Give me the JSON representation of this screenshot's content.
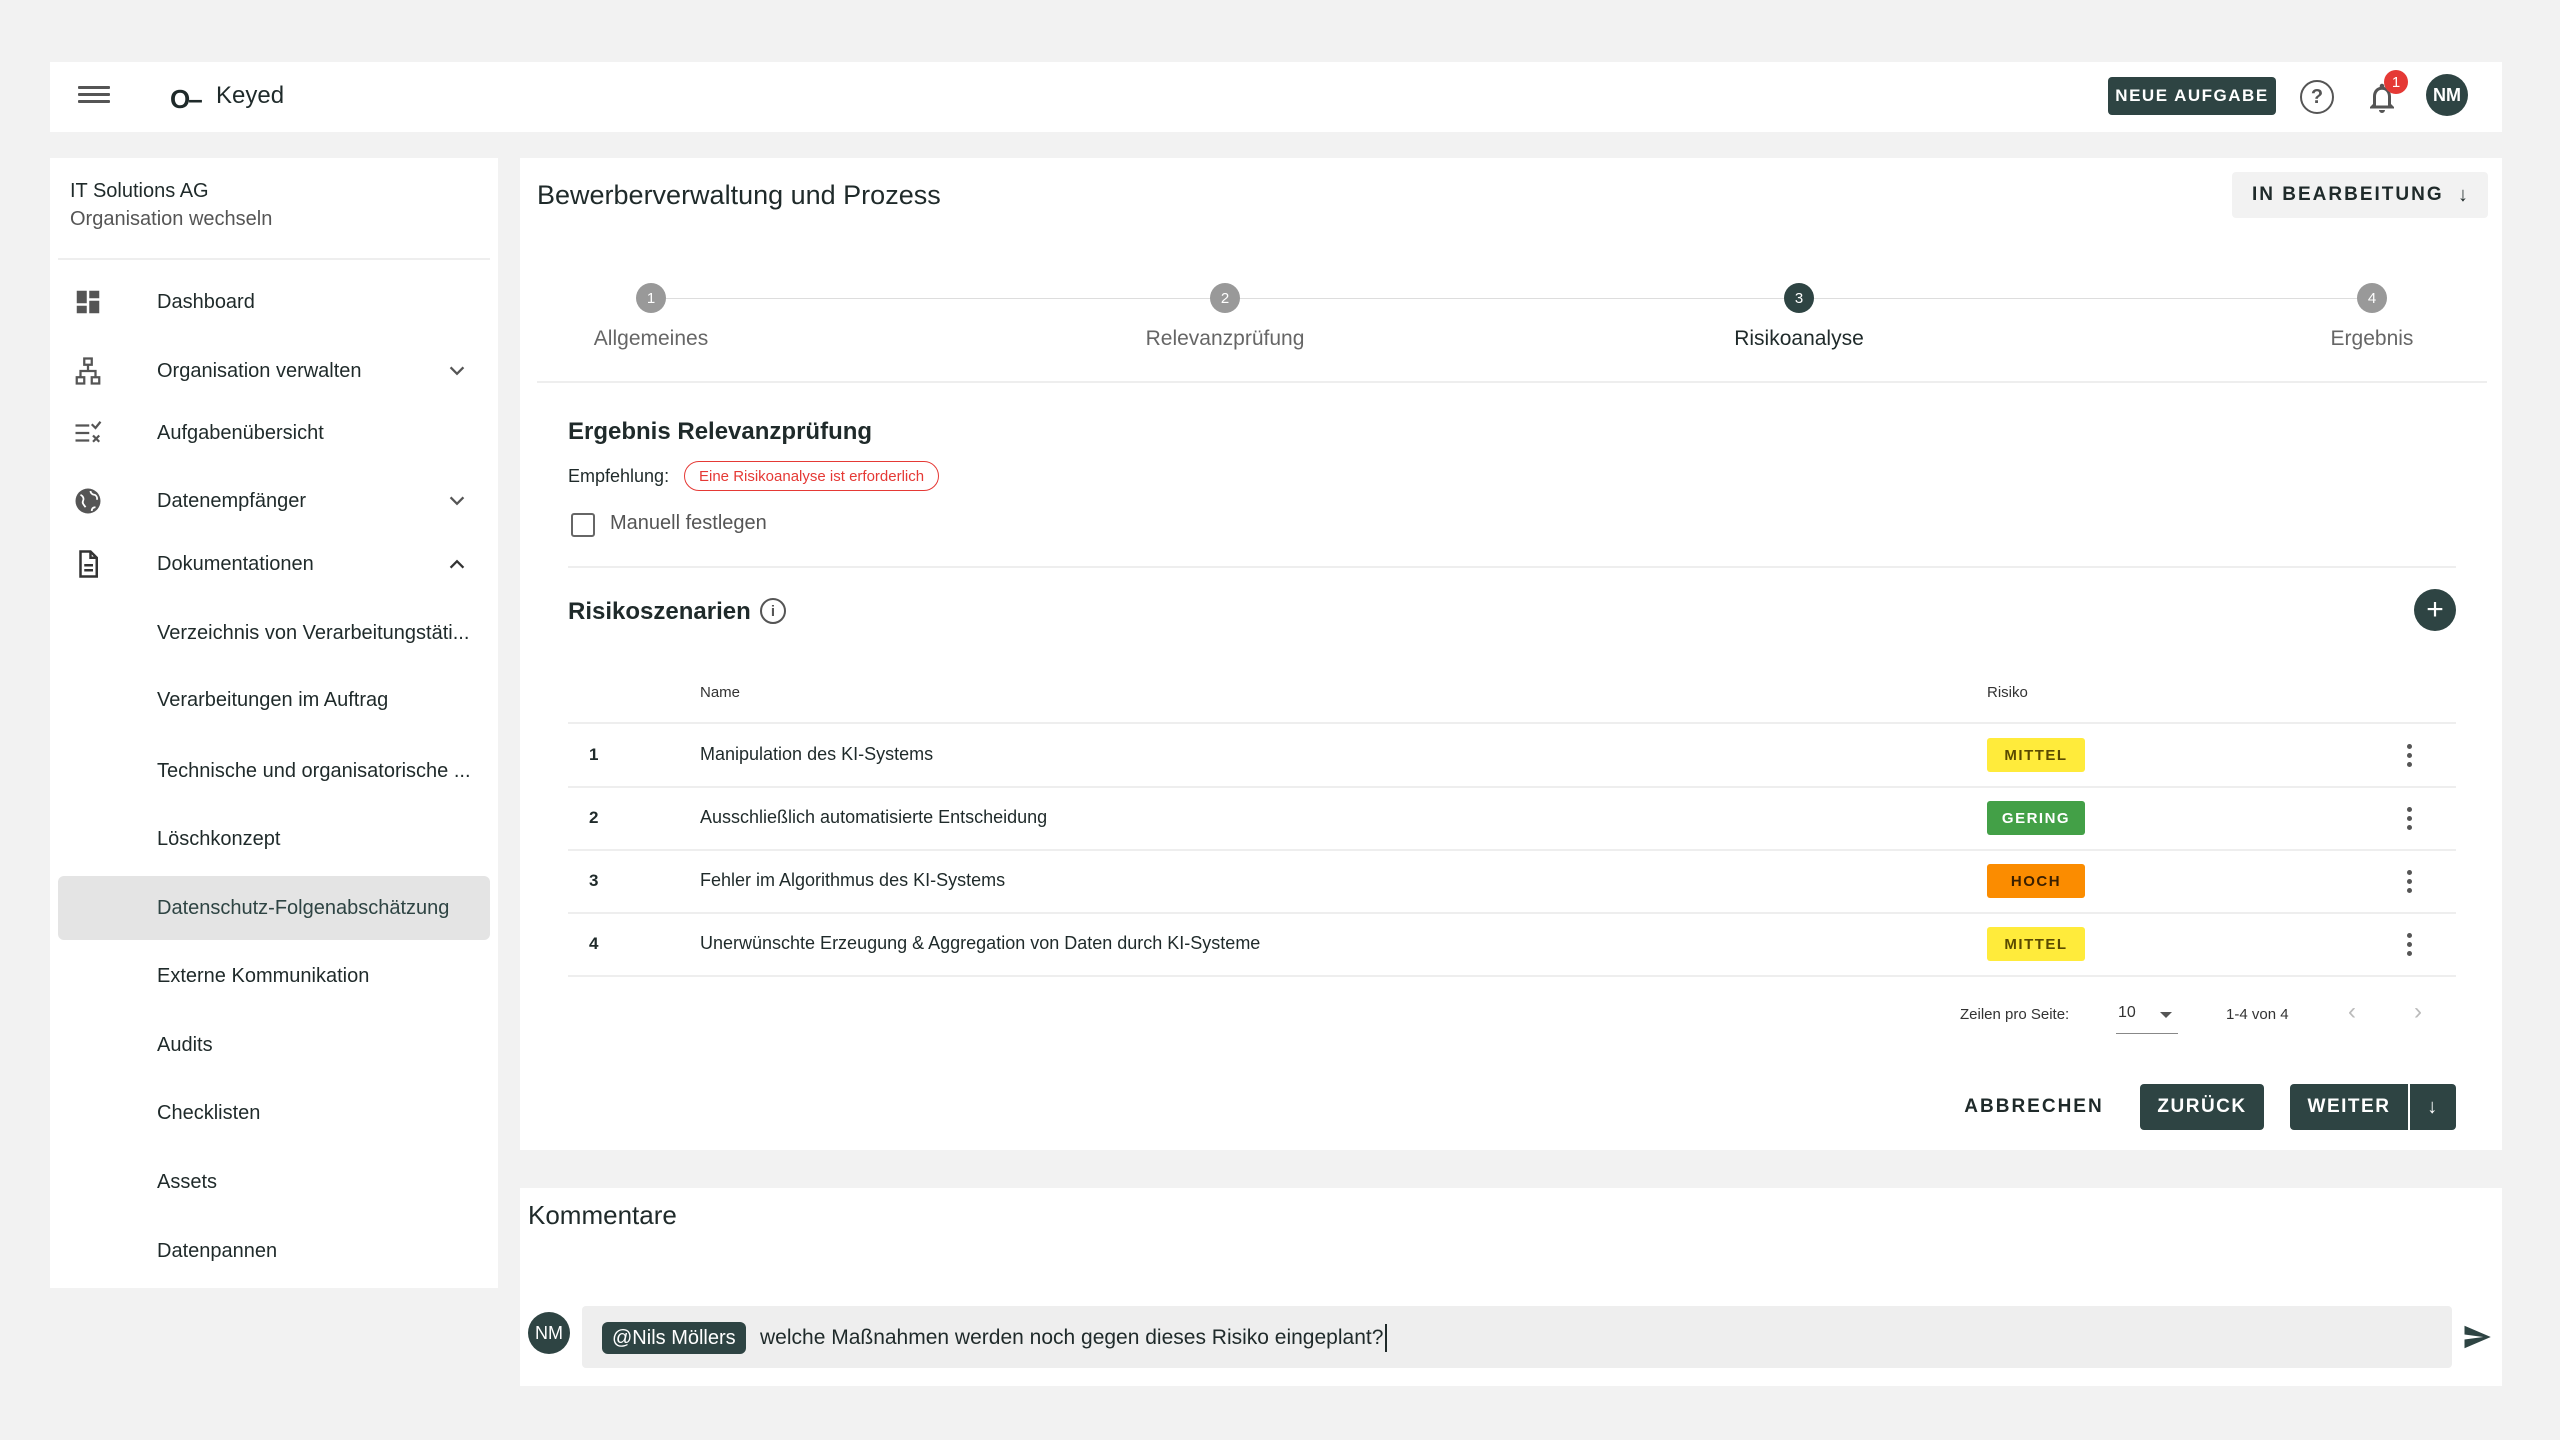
{
  "app": {
    "logo_mark": "O–",
    "logo_text": "Keyed",
    "new_task_label": "NEUE AUFGABE",
    "help_glyph": "?",
    "notifications_count": "1",
    "user_initials": "NM"
  },
  "sidebar": {
    "org_name": "IT Solutions AG",
    "org_switch": "Organisation wechseln",
    "items": [
      {
        "label": "Dashboard",
        "icon": "dashboard-icon"
      },
      {
        "label": "Organisation verwalten",
        "icon": "sitemap-icon",
        "chevron": "down"
      },
      {
        "label": "Aufgabenübersicht",
        "icon": "checklist-icon"
      },
      {
        "label": "Datenempfänger",
        "icon": "globe-icon",
        "chevron": "down"
      },
      {
        "label": "Dokumentationen",
        "icon": "document-icon",
        "chevron": "up"
      }
    ],
    "sub_items": [
      "Verzeichnis von Verarbeitungstäti...",
      "Verarbeitungen im Auftrag",
      "Technische und organisatorische ...",
      "Löschkonzept",
      "Datenschutz-Folgenabschätzung",
      "Externe Kommunikation",
      "Audits",
      "Checklisten",
      "Assets",
      "Datenpannen"
    ],
    "active_sub_item": "Datenschutz-Folgenabschätzung"
  },
  "main": {
    "title": "Bewerberverwaltung und Prozess",
    "status_label": "IN BEARBEITUNG",
    "status_arrow": "↓",
    "steps": [
      {
        "number": "1",
        "label": "Allgemeines"
      },
      {
        "number": "2",
        "label": "Relevanzprüfung"
      },
      {
        "number": "3",
        "label": "Risikoanalyse"
      },
      {
        "number": "4",
        "label": "Ergebnis"
      }
    ],
    "current_step": 3,
    "relevance": {
      "title": "Ergebnis Relevanzprüfung",
      "recommendation_label": "Empfehlung:",
      "recommendation_value": "Eine Risikoanalyse ist erforderlich",
      "manual_label": "Manuell festlegen",
      "manual_checked": false
    },
    "scenarios": {
      "title": "Risikoszenarien",
      "info_glyph": "i",
      "add_glyph": "+",
      "columns": {
        "name": "Name",
        "risk": "Risiko"
      },
      "rows": [
        {
          "num": "1",
          "name": "Manipulation des KI-Systems",
          "risk": "MITTEL",
          "risk_color": "#ffeb3b",
          "risk_text": "#5a4a00"
        },
        {
          "num": "2",
          "name": "Ausschließlich automatisierte Entscheidung",
          "risk": "GERING",
          "risk_color": "#43a047",
          "risk_text": "#ffffff"
        },
        {
          "num": "3",
          "name": "Fehler im Algorithmus des KI-Systems",
          "risk": "HOCH",
          "risk_color": "#fb8c00",
          "risk_text": "#3a1f00"
        },
        {
          "num": "4",
          "name": "Unerwünschte Erzeugung & Aggregation von Daten durch KI-Systeme",
          "risk": "MITTEL",
          "risk_color": "#ffeb3b",
          "risk_text": "#5a4a00"
        }
      ],
      "pagination": {
        "rows_per_page_label": "Zeilen pro Seite:",
        "rows_per_page": "10",
        "range": "1-4 von 4",
        "prev": "‹",
        "next": "›"
      }
    },
    "actions": {
      "cancel": "ABBRECHEN",
      "back": "ZURÜCK",
      "next": "WEITER",
      "next_arrow": "↓"
    }
  },
  "comments": {
    "title": "Kommentare",
    "author_initials": "NM",
    "mention": "@Nils Möllers",
    "draft_text": "welche Maßnahmen werden noch gegen dieses Risiko eingeplant?"
  },
  "colors": {
    "accent": "#2e4443",
    "badge_red": "#e53935",
    "recommendation_red": "#e53935"
  }
}
